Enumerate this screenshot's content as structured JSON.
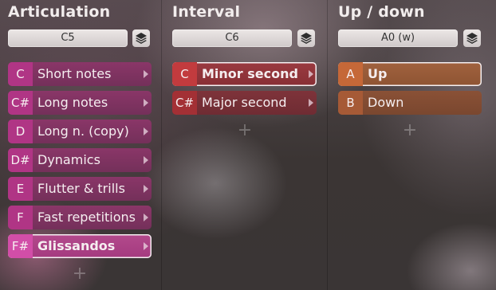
{
  "columns": [
    {
      "title": "Articulation",
      "preset": "C5",
      "items": [
        {
          "key": "C",
          "label": "Short notes",
          "selected": false
        },
        {
          "key": "C#",
          "label": "Long notes",
          "selected": false
        },
        {
          "key": "D",
          "label": "Long n. (copy)",
          "selected": false
        },
        {
          "key": "D#",
          "label": "Dynamics",
          "selected": false
        },
        {
          "key": "E",
          "label": "Flutter & trills",
          "selected": false
        },
        {
          "key": "F",
          "label": "Fast repetitions",
          "selected": false
        },
        {
          "key": "F#",
          "label": "Glissandos",
          "selected": true
        }
      ],
      "add_label": "+"
    },
    {
      "title": "Interval",
      "preset": "C6",
      "items": [
        {
          "key": "C",
          "label": "Minor second",
          "selected": true
        },
        {
          "key": "C#",
          "label": "Major second",
          "selected": false
        }
      ],
      "add_label": "+"
    },
    {
      "title": "Up / down",
      "preset": "A0 (w)",
      "items": [
        {
          "key": "A",
          "label": "Up",
          "selected": true
        },
        {
          "key": "B",
          "label": "Down",
          "selected": false
        }
      ],
      "add_label": "+"
    }
  ],
  "icons": {
    "stack": "layers-icon",
    "submenu": "chevron-right-icon",
    "add": "plus-icon"
  },
  "colors": {
    "articulation": "#b03585",
    "interval": "#a33035",
    "updown": "#a65a36"
  }
}
